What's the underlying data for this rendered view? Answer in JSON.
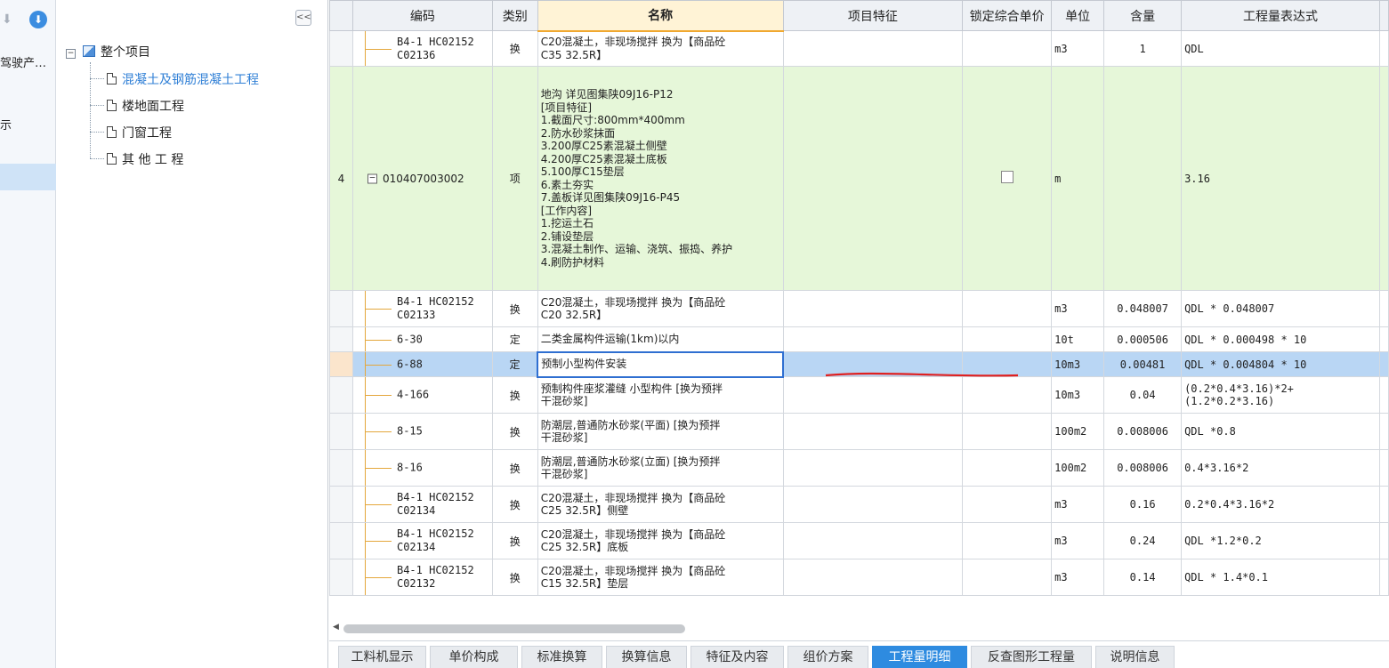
{
  "leftnav": {
    "items": [
      {
        "label": "驾驶产…"
      },
      {
        "label": "示"
      }
    ]
  },
  "tree": {
    "root": "整个项目",
    "children": [
      {
        "label": "混凝土及钢筋混凝土工程",
        "selected": true
      },
      {
        "label": "楼地面工程"
      },
      {
        "label": "门窗工程"
      },
      {
        "label": "其 他 工 程"
      }
    ],
    "collapse_label": "<<"
  },
  "grid": {
    "headers": [
      "编码",
      "类别",
      "名称",
      "项目特征",
      "锁定综合单价",
      "单位",
      "含量",
      "工程量表达式"
    ],
    "rows": [
      {
        "rn": "",
        "code": [
          "B4-1 HC02152",
          "C02136"
        ],
        "cat": "换",
        "name": [
          "C20混凝土，非现场搅拌  换为【商品砼",
          "C35 32.5R】"
        ],
        "unit": "m3",
        "qty": "1",
        "expr": [
          "QDL"
        ]
      },
      {
        "rn": "4",
        "code": [
          "010407003002"
        ],
        "cat": "项",
        "name": [
          "地沟   详见图集陕09J16-P12",
          "[项目特征]",
          "1.截面尺寸:800mm*400mm",
          "2.防水砂浆抹面",
          "3.200厚C25素混凝土侧壁",
          "4.200厚C25素混凝土底板",
          "5.100厚C15垫层",
          "6.素土夯实",
          "7.盖板详见图集陕09J16-P45",
          "[工作内容]",
          "1.挖运土石",
          "2.铺设垫层",
          "3.混凝土制作、运输、浇筑、振捣、养护",
          "4.刷防护材料"
        ],
        "unit": "m",
        "qty": "",
        "expr": [
          "3.16"
        ]
      },
      {
        "rn": "",
        "code": [
          "B4-1 HC02152",
          "C02133"
        ],
        "cat": "换",
        "name": [
          "C20混凝土，非现场搅拌  换为【商品砼",
          "C20 32.5R】"
        ],
        "unit": "m3",
        "qty": "0.048007",
        "expr": [
          "QDL * 0.048007"
        ]
      },
      {
        "rn": "",
        "code": [
          "6-30"
        ],
        "cat": "定",
        "name": [
          "二类金属构件运输(1km)以内"
        ],
        "unit": "10t",
        "qty": "0.000506",
        "expr": [
          "QDL * 0.000498 * 10"
        ]
      },
      {
        "rn": "",
        "code": [
          "6-88"
        ],
        "cat": "定",
        "name": [
          "预制小型构件安装"
        ],
        "unit": "10m3",
        "qty": "0.00481",
        "expr": [
          "QDL * 0.004804 * 10"
        ]
      },
      {
        "rn": "",
        "code": [
          "4-166"
        ],
        "cat": "换",
        "name": [
          "预制构件座浆灌缝 小型构件  [换为预拌",
          "干混砂浆]"
        ],
        "unit": "10m3",
        "qty": "0.04",
        "expr": [
          "(0.2*0.4*3.16)*2+",
          "(1.2*0.2*3.16)"
        ]
      },
      {
        "rn": "",
        "code": [
          "8-15"
        ],
        "cat": "换",
        "name": [
          "防潮层,普通防水砂浆(平面)  [换为预拌",
          "干混砂浆]"
        ],
        "unit": "100m2",
        "qty": "0.008006",
        "expr": [
          "QDL *0.8"
        ]
      },
      {
        "rn": "",
        "code": [
          "8-16"
        ],
        "cat": "换",
        "name": [
          "防潮层,普通防水砂浆(立面)  [换为预拌",
          "干混砂浆]"
        ],
        "unit": "100m2",
        "qty": "0.008006",
        "expr": [
          "0.4*3.16*2"
        ]
      },
      {
        "rn": "",
        "code": [
          "B4-1 HC02152",
          "C02134"
        ],
        "cat": "换",
        "name": [
          "C20混凝土，非现场搅拌  换为【商品砼",
          "C25 32.5R】侧壁"
        ],
        "unit": "m3",
        "qty": "0.16",
        "expr": [
          "0.2*0.4*3.16*2"
        ]
      },
      {
        "rn": "",
        "code": [
          "B4-1 HC02152",
          "C02134"
        ],
        "cat": "换",
        "name": [
          "C20混凝土，非现场搅拌  换为【商品砼",
          "C25 32.5R】底板"
        ],
        "unit": "m3",
        "qty": "0.24",
        "expr": [
          "QDL *1.2*0.2"
        ]
      },
      {
        "rn": "",
        "code": [
          "B4-1 HC02152",
          "C02132"
        ],
        "cat": "换",
        "name": [
          "C20混凝土，非现场搅拌  换为【商品砼",
          "C15 32.5R】垫层"
        ],
        "unit": "m3",
        "qty": "0.14",
        "expr": [
          "QDL * 1.4*0.1"
        ]
      }
    ]
  },
  "tabs": [
    "工料机显示",
    "单价构成",
    "标准换算",
    "换算信息",
    "特征及内容",
    "组价方案",
    "工程量明细",
    "反查图形工程量",
    "说明信息"
  ],
  "active_tab": "工程量明细",
  "colors": {
    "accent": "#2e8be0",
    "green_row": "#e6f7d9",
    "selected_row": "#b9d6f4",
    "annotation": "#e02020"
  }
}
